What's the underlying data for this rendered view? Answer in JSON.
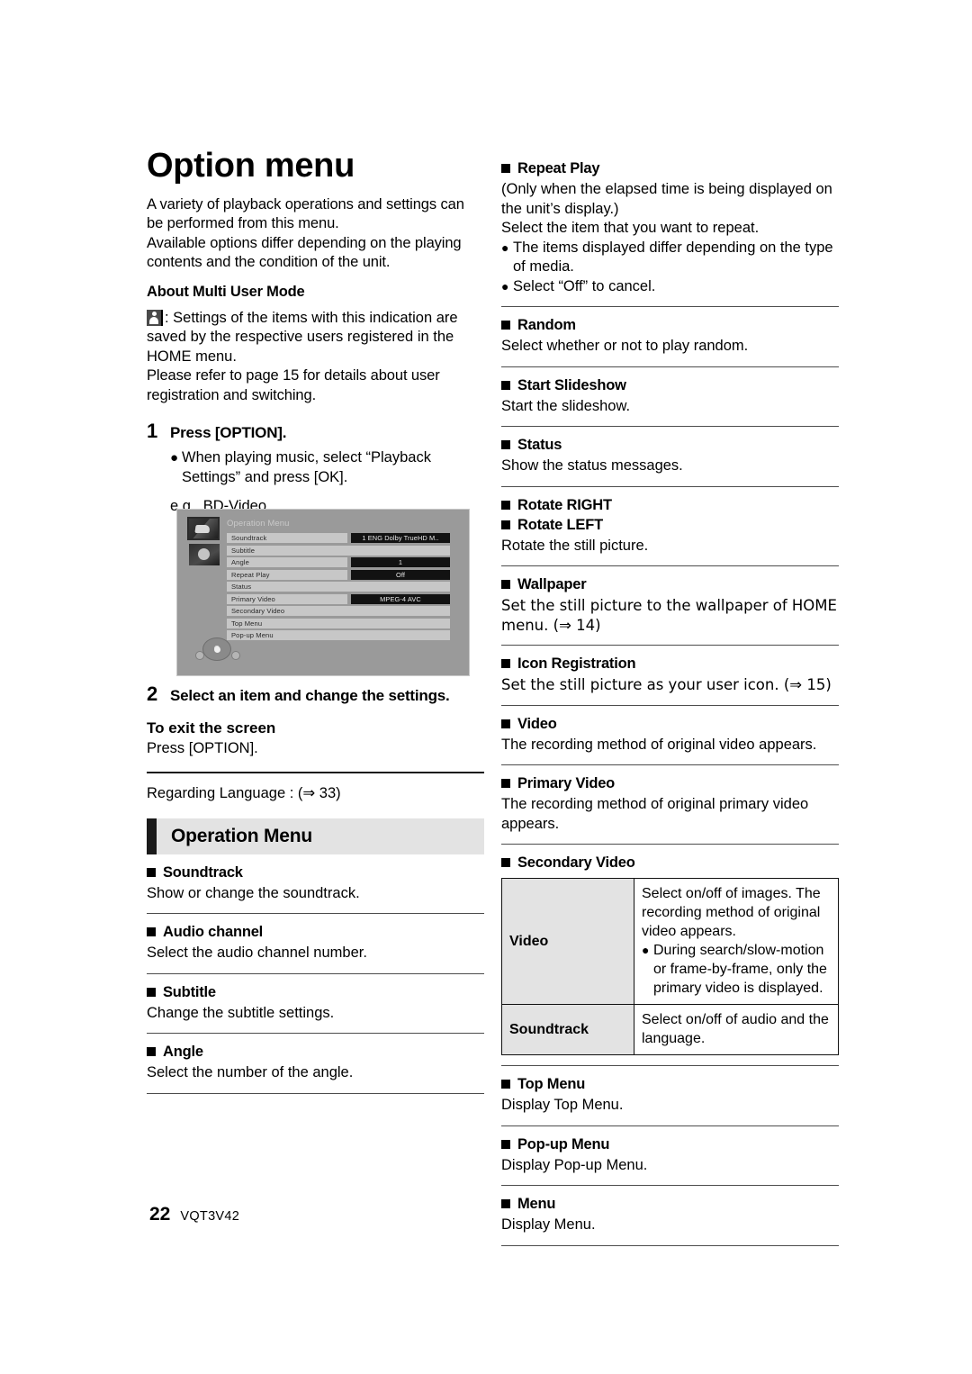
{
  "page": {
    "number": "22",
    "code": "VQT3V42"
  },
  "left": {
    "title": "Option menu",
    "intro": [
      "A variety of playback operations and settings can be performed from this menu.",
      "Available options differ depending on the playing contents and the condition of the unit."
    ],
    "multi_user_heading": "About Multi User Mode",
    "multi_user_icon": "person-icon",
    "multi_user_text": ": Settings of the items with this indication are saved by the respective users registered in the HOME menu.",
    "multi_user_text2": "Please refer to page 15 for details about user registration and switching.",
    "step1": {
      "number": "1",
      "label": "Press [OPTION].",
      "bullet": "When playing music, select “Playback Settings” and press [OK].",
      "eg": "e.g., BD-Video"
    },
    "step2": {
      "number": "2",
      "label": "Select an item and change the settings."
    },
    "exit": {
      "heading": "To exit the screen",
      "text": "Press [OPTION]."
    },
    "regarding": "Regarding Language : (⇒ 33)",
    "section_title": "Operation Menu",
    "items": [
      {
        "title": "Soundtrack",
        "desc": "Show or change the soundtrack."
      },
      {
        "title": "Audio channel",
        "desc": "Select the audio channel number."
      },
      {
        "title": "Subtitle",
        "desc": "Change the subtitle settings."
      },
      {
        "title": "Angle",
        "desc": "Select the number of the angle."
      }
    ]
  },
  "device_screenshot": {
    "title": "Operation Menu",
    "rows": [
      {
        "label": "Soundtrack",
        "value": "1 ENG Dolby TrueHD M.."
      },
      {
        "label": "Subtitle",
        "value": ""
      },
      {
        "label": "Angle",
        "value": "1"
      },
      {
        "label": "Repeat Play",
        "value": "Off"
      },
      {
        "label": "Status",
        "value": ""
      },
      {
        "label": "Primary Video",
        "value": "MPEG-4 AVC"
      },
      {
        "label": "Secondary Video",
        "value": ""
      },
      {
        "label": "Top Menu",
        "value": ""
      },
      {
        "label": "Pop-up Menu",
        "value": ""
      }
    ]
  },
  "right": {
    "items": [
      {
        "title": "Repeat Play",
        "lines": [
          "(Only when the elapsed time is being displayed on the unit’s display.)",
          "Select the item that you want to repeat."
        ],
        "bullets": [
          "The items displayed differ depending on the type of media.",
          "Select “Off” to cancel."
        ]
      },
      {
        "title": "Random",
        "lines": [
          "Select whether or not to play random."
        ],
        "bullets": []
      },
      {
        "title": "Start Slideshow",
        "lines": [
          "Start the slideshow."
        ],
        "bullets": []
      },
      {
        "title": "Status",
        "lines": [
          "Show the status messages."
        ],
        "bullets": []
      },
      {
        "title": "Rotate RIGHT",
        "title2": "Rotate LEFT",
        "lines": [
          "Rotate the still picture."
        ],
        "bullets": []
      },
      {
        "title": "Wallpaper",
        "lines": [
          "Set the still picture to the wallpaper of HOME menu. (⇒ 14)"
        ],
        "bullets": []
      },
      {
        "title": "Icon Registration",
        "lines": [
          "Set the still picture as your user icon. (⇒ 15)"
        ],
        "bullets": []
      },
      {
        "title": "Video",
        "lines": [
          "The recording method of original video appears."
        ],
        "bullets": []
      },
      {
        "title": "Primary Video",
        "lines": [
          "The recording method of original primary video appears."
        ],
        "bullets": []
      }
    ],
    "secondary_video": {
      "title": "Secondary Video",
      "rows": [
        {
          "key": "Video",
          "lines": [
            "Select on/off of images. The recording method of original video appears."
          ],
          "bullets": [
            "During search/slow-motion or frame-by-frame, only the primary video is displayed."
          ]
        },
        {
          "key": "Soundtrack",
          "lines": [
            "Select on/off of audio and the language."
          ],
          "bullets": []
        }
      ]
    },
    "tail_items": [
      {
        "title": "Top Menu",
        "lines": [
          "Display Top Menu."
        ]
      },
      {
        "title": "Pop-up Menu",
        "lines": [
          "Display Pop-up Menu."
        ]
      },
      {
        "title": "Menu",
        "lines": [
          "Display Menu."
        ]
      }
    ]
  }
}
